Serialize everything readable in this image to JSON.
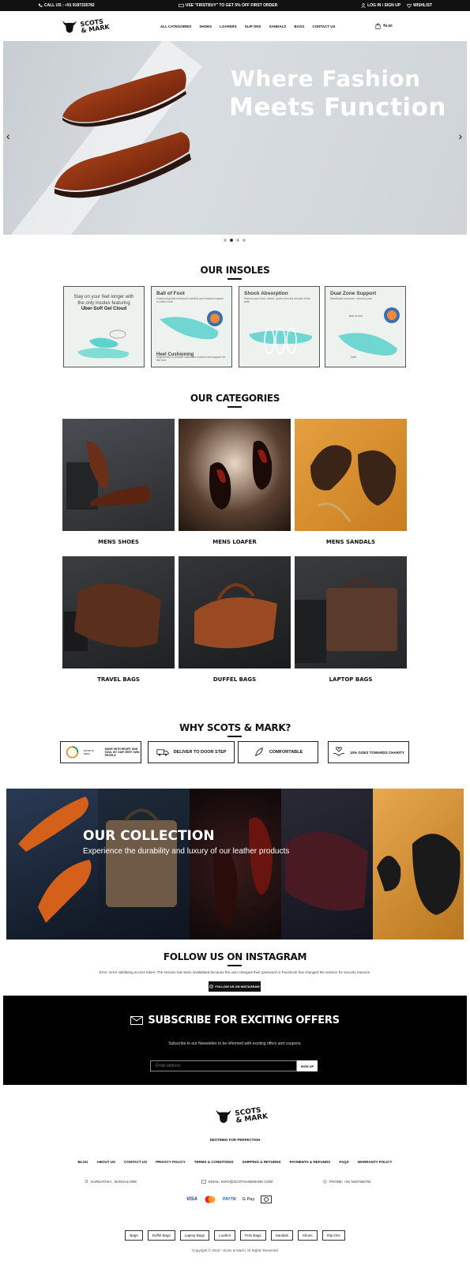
{
  "topbar": {
    "call": "CALL US : +91 9187335782",
    "promo": "USE \"FIRSTBUY\" TO GET 5% OFF FIRST ORDER",
    "login": "LOG IN / SIGN UP",
    "wishlist": "WISHLIST"
  },
  "header": {
    "logo_line1": "SCOTS",
    "logo_line2": "& MARK",
    "nav": [
      "ALL CATEGORIES",
      "SHOES",
      "LOAFERS",
      "SLIP ONS",
      "SANDALS",
      "BAGS",
      "CONTACT US"
    ],
    "cart": "₹0.00"
  },
  "hero": {
    "line1": "Where Fashion",
    "line2": "Meets Function"
  },
  "insoles": {
    "title": "OUR INSOLES",
    "cards": [
      {
        "title": "",
        "line1": "Stay on your feet longer with",
        "line2": "the only insoles featuring",
        "line3": "Uber-Soft Gel Cloud"
      },
      {
        "title": "Ball of Foot",
        "sub": "Cushioning that enhances comfort and reduces impact on ball of foot",
        "foot": "Heel Cushioning",
        "footsub": "Engineered to provide maximum comfort and support for the heel"
      },
      {
        "title": "Shock Absorption",
        "sub": "Relieve your heel, knees, spine from the shocks of the walk"
      },
      {
        "title": "Dual Zone Support",
        "sub": "Distributes pressure, reduces pain",
        "ball": "Ball of foot",
        "heel": "Heel"
      }
    ]
  },
  "categories": {
    "title": "OUR CATEGORIES",
    "items": [
      "MENS SHOES",
      "MENS LOAFER",
      "MENS SANDALS",
      "TRAVEL BAGS",
      "DUFFEL BAGS",
      "LAPTOP BAGS"
    ]
  },
  "why": {
    "title": "WHY SCOTS & MARK?",
    "items": [
      "MADE WITH HEART AND SOUL BY OUR VERY OWN PEOPLE",
      "DELIVER TO DOOR STEP",
      "COMFORTABLE",
      "10% GOES TOWARDS CHARITY"
    ],
    "badge": "MADE IN INDIA"
  },
  "collection": {
    "title": "OUR COLLECTION",
    "subtitle": "Experience the durability and luxury of our leather products"
  },
  "instagram": {
    "title": "FOLLOW US ON INSTAGRAM",
    "error": "Error: Error validating access token: The session has been invalidated because the user changed their password or Facebook has changed the session for security reasons.",
    "button": "FOLLOW US ON INSTAGRAM"
  },
  "subscribe": {
    "title": "SUBSCRIBE FOR EXCITING OFFERS",
    "desc": "Subscribe to our Newsletter to be informed with exciting offers and coupons.",
    "placeholder": "Email address",
    "button": "SIGN UP"
  },
  "footer": {
    "tagline": "DESTINED FOR PERFECTION",
    "links": [
      "BLOG",
      "ABOUT US",
      "CONTACT US",
      "PRIVACY POLICY",
      "TERMS & CONDITIONS",
      "SHIPPING & RETURNS",
      "PAYMENTS & REFUNDS",
      "FAQS",
      "WARRANTY POLICY"
    ],
    "location": "KARNATAKA , BANGALORE",
    "email": "EMAIL: INFO@SCOTSANDMARK.COM",
    "phone": "PHONE: +91 9187335782",
    "payments": [
      "VISA",
      "",
      "PAYTM",
      "G Pay",
      ""
    ],
    "tags": [
      "Bags",
      "Duffel Bags",
      "Laptop Bags",
      "Loafers",
      "Polo Bags",
      "Sandals",
      "Shoes",
      "Slip Ons"
    ],
    "copyright": "Copyright © 2023 - Scots & Mark | All Rights Reserved"
  }
}
